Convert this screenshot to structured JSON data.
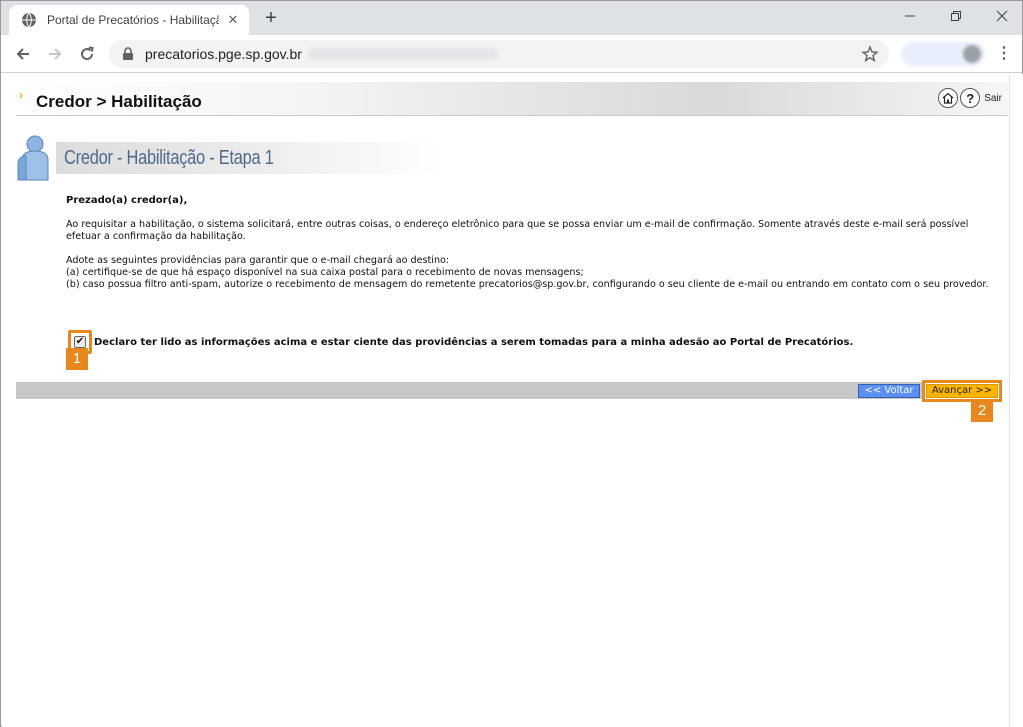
{
  "browser": {
    "tab_title": "Portal de Precatórios - Habilitaçã",
    "url": "precatorios.pge.sp.gov.br"
  },
  "header": {
    "title": "Credor > Habilitação",
    "sair_label": "Sair"
  },
  "step": {
    "title": "Credor - Habilitação - Etapa 1"
  },
  "content": {
    "greeting": "Prezado(a) credor(a),",
    "paragraph1": "Ao requisitar a habilitação, o sistema solicitará, entre outras coisas, o endereço eletrônico para que se possa enviar um e-mail de confirmação. Somente através deste e-mail será possível efetuar a confirmação da habilitação.",
    "paragraph2_intro": "Adote as seguintes providências para garantir que o e-mail chegará ao destino:",
    "paragraph2_a": "(a) certifique-se de que há espaço disponível na sua caixa postal para o recebimento de novas mensagens;",
    "paragraph2_b": "(b) caso possua filtro anti-spam, autorize o recebimento de mensagem do remetente precatorios@sp.gov.br, configurando o seu cliente de e-mail ou entrando em contato com o seu provedor."
  },
  "declaration": {
    "text": "Declaro ter lido as informações acima e estar ciente das providências a serem tomadas para a minha adesão ao Portal de Precatórios.",
    "checked": true
  },
  "buttons": {
    "voltar": "<< Voltar",
    "avancar": "Avançar >>"
  },
  "annotations": {
    "badge1": "1",
    "badge2": "2",
    "highlight_color": "#e8871e"
  },
  "icons": [
    "globe-icon",
    "close-icon",
    "plus-icon",
    "minimize-icon",
    "maximize-icon",
    "window-close-icon",
    "back-icon",
    "forward-icon",
    "reload-icon",
    "lock-icon",
    "star-icon",
    "menu-icon",
    "home-icon",
    "help-icon",
    "user-icon"
  ]
}
